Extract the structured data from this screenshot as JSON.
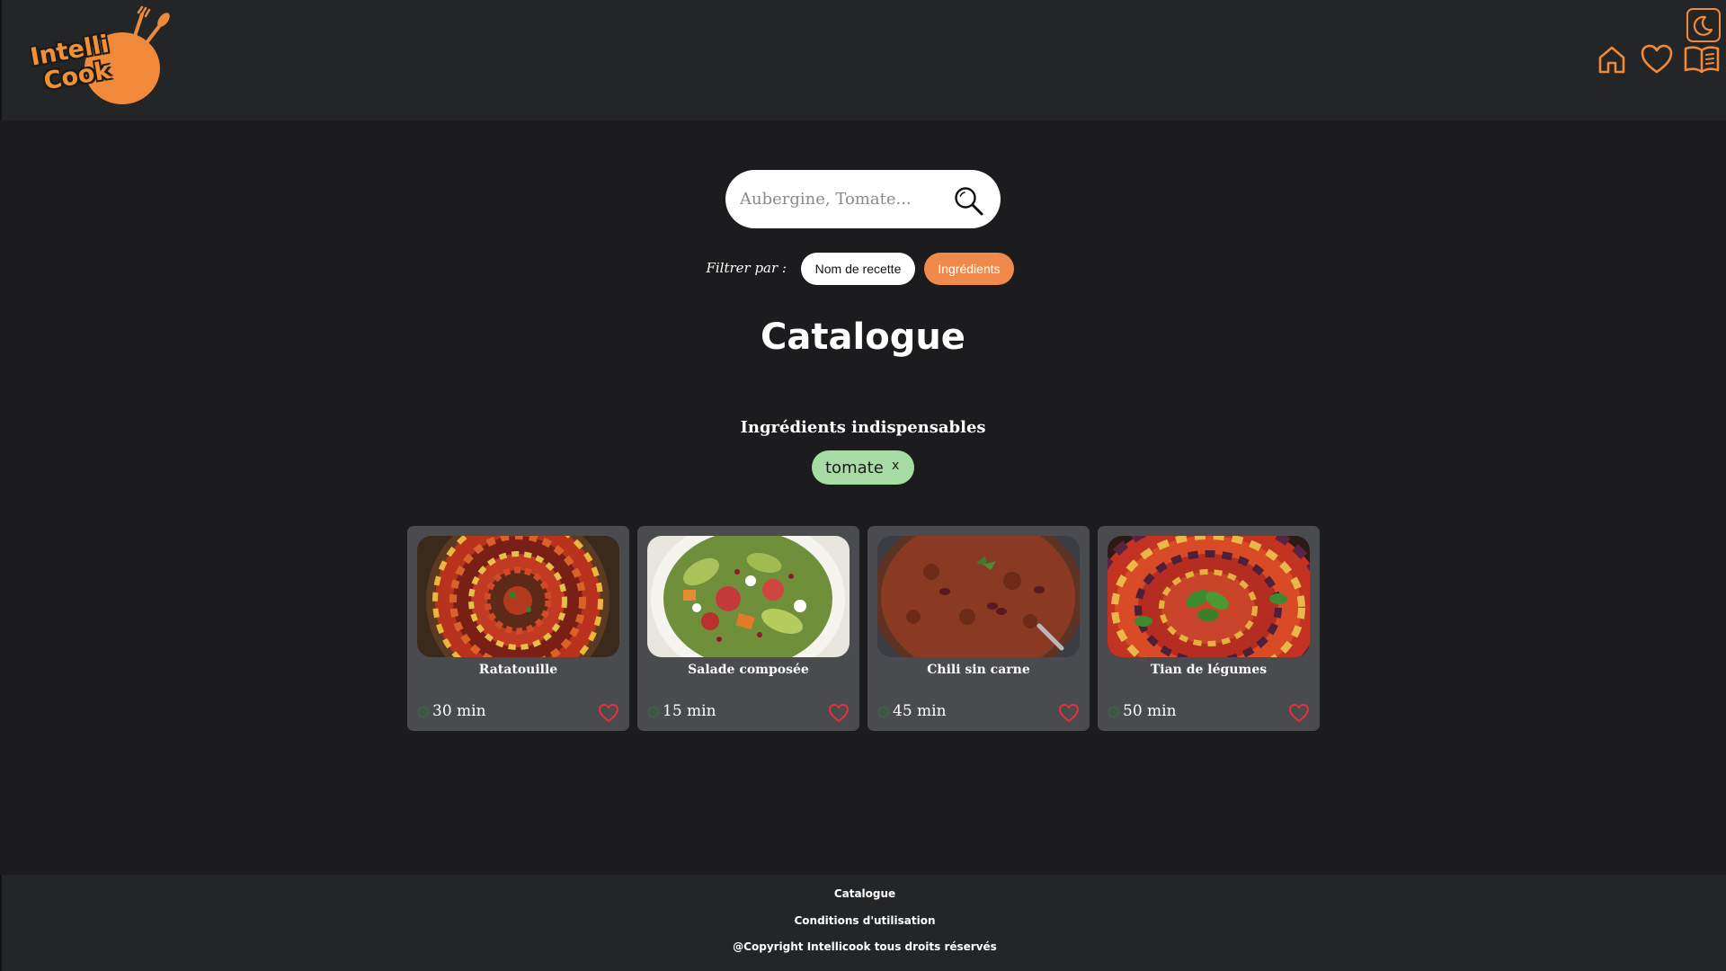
{
  "header": {
    "logo_text_line1": "Intelli",
    "logo_text_line2": "Cook",
    "icons": [
      "moon-icon",
      "home-icon",
      "heart-icon",
      "book-icon"
    ]
  },
  "search": {
    "placeholder": "Aubergine, Tomate...",
    "value": ""
  },
  "filter": {
    "label": "Filtrer par :",
    "options": [
      "Nom de recette",
      "Ingrédients"
    ],
    "active": "Ingrédients"
  },
  "main": {
    "title": "Catalogue",
    "ingredients_heading": "Ingrédients indispensables",
    "ingredient_chips": [
      {
        "label": "tomate",
        "close": "x"
      }
    ]
  },
  "recipes": [
    {
      "name": "Ratatouille",
      "time": "30 min"
    },
    {
      "name": "Salade composée",
      "time": "15 min"
    },
    {
      "name": "Chili sin carne",
      "time": "45 min"
    },
    {
      "name": "Tian de légumes",
      "time": "50 min"
    }
  ],
  "footer": {
    "links": [
      "Catalogue",
      "Conditions d'utilisation",
      "@Copyright Intellicook tous droits réservés"
    ]
  },
  "colors": {
    "accent": "#f08a3a",
    "background": "#1c1c1e",
    "header_bg": "#242527",
    "card_bg": "#4a4b4e",
    "chip_bg": "#a8dca5",
    "heart": "#e0333a"
  }
}
